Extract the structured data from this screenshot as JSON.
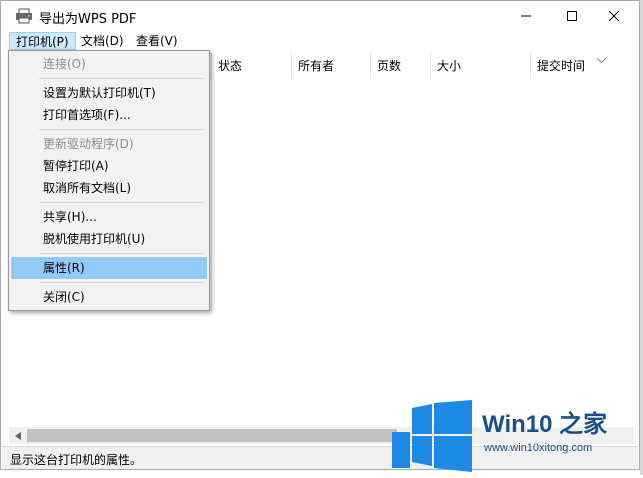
{
  "window": {
    "title": "导出为WPS PDF"
  },
  "menubar": {
    "printer": "打印机(P)",
    "document": "文档(D)",
    "view": "查看(V)"
  },
  "columns": [
    "状态",
    "所有者",
    "页数",
    "大小",
    "提交时间"
  ],
  "dropdown": {
    "connect": "连接(O)",
    "set_default": "设置为默认打印机(T)",
    "preferences": "打印首选项(F)...",
    "update_driver": "更新驱动程序(D)",
    "pause": "暂停打印(A)",
    "cancel_all": "取消所有文档(L)",
    "share": "共享(H)...",
    "offline": "脱机使用打印机(U)",
    "properties": "属性(R)",
    "close": "关闭(C)"
  },
  "status": {
    "text": "显示这台打印机的属性。"
  },
  "watermark": {
    "brand": "Win10 之家",
    "url": "www.win10xitong.com"
  },
  "colors": {
    "highlight": "#91c9f7",
    "logo_blue": "#1e88e5",
    "active_menu": "#cce8ff"
  }
}
